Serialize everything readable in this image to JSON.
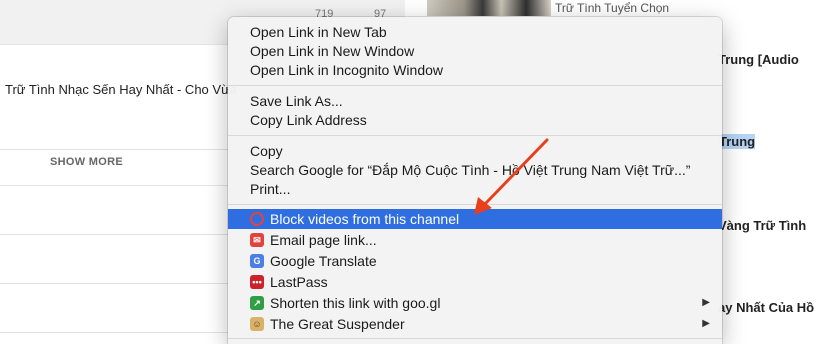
{
  "background": {
    "left_description": "Trữ Tình Nhạc Sến Hay Nhất - Cho Vừa",
    "show_more": "SHOW MORE",
    "likes": "719",
    "dislikes": "97",
    "right_items": [
      "Trữ Tình Tuyển Chọn",
      "Trung [Audio",
      "Trung",
      "Vàng Trữ Tình",
      "ay Nhất Của Hồ"
    ]
  },
  "menu": {
    "group1": [
      "Open Link in New Tab",
      "Open Link in New Window",
      "Open Link in Incognito Window"
    ],
    "group2": [
      "Save Link As...",
      "Copy Link Address"
    ],
    "group3": [
      "Copy",
      "Search Google for “Đắp Mộ Cuộc Tình - Hồ Việt Trung Nam Việt Trữ...”",
      "Print..."
    ],
    "extensions": [
      {
        "label": "Block videos from this channel",
        "icon": "block-icon",
        "color": "#e0443e",
        "active": true,
        "submenu": false
      },
      {
        "label": "Email page link...",
        "icon": "email-icon",
        "color": "#e0443e",
        "active": false,
        "submenu": false
      },
      {
        "label": "Google Translate",
        "icon": "translate-icon",
        "color": "#4a7fe8",
        "active": false,
        "submenu": false
      },
      {
        "label": "LastPass",
        "icon": "lastpass-icon",
        "color": "#cc2229",
        "active": false,
        "submenu": false
      },
      {
        "label": "Shorten this link with goo.gl",
        "icon": "link-icon",
        "color": "#2f9e44",
        "active": false,
        "submenu": true
      },
      {
        "label": "The Great Suspender",
        "icon": "suspender-icon",
        "color": "#d9b26a",
        "active": false,
        "submenu": true
      }
    ]
  },
  "annotation": {
    "arrow_color": "#e8401c"
  }
}
